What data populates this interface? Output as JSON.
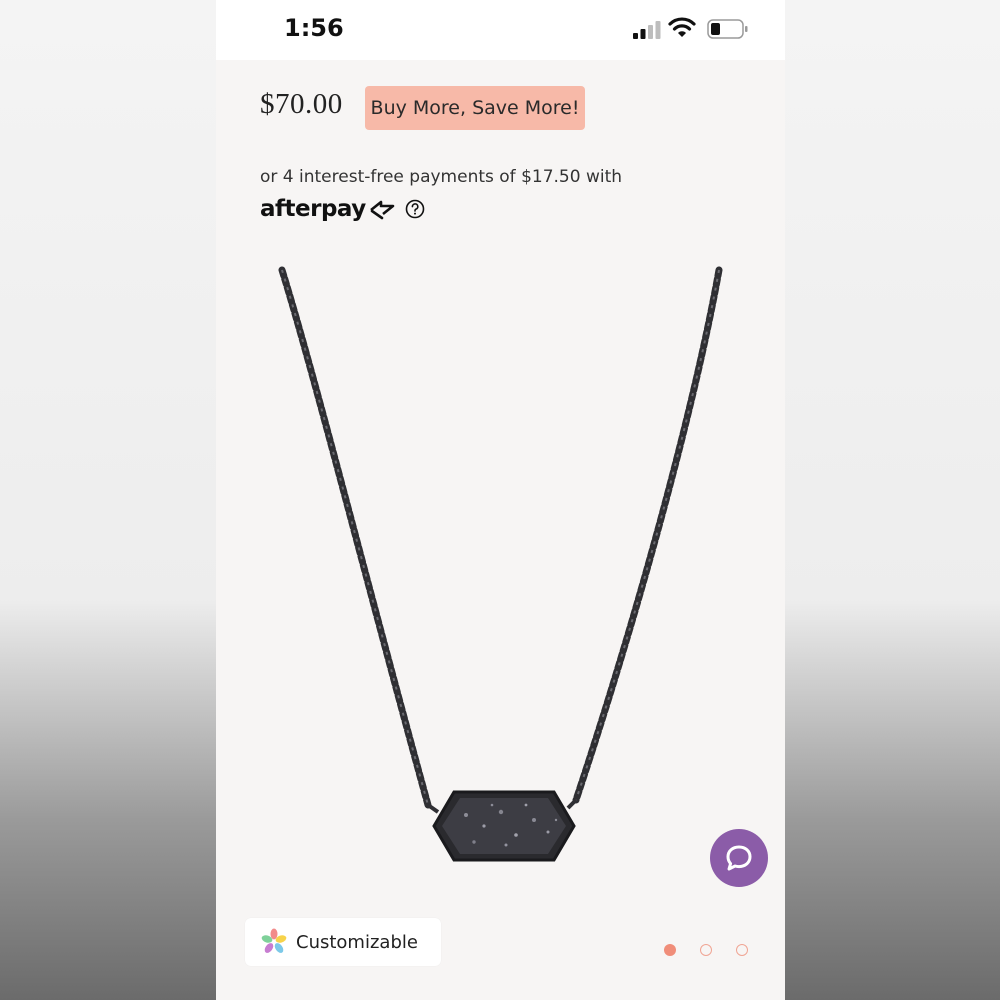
{
  "status_bar": {
    "time": "1:56"
  },
  "product": {
    "price": "$70.00",
    "promo_badge": "Buy More, Save More!",
    "installment_text": "or 4 interest-free payments of $17.50 with",
    "afterpay_logo": "afterpay",
    "image_name": "necklace-product-image"
  },
  "chips": {
    "customizable_label": "Customizable"
  },
  "carousel": {
    "page_count": 3,
    "active_index": 0
  },
  "colors": {
    "promo_badge_bg": "#f7b9a8",
    "chat_button": "#8b5ca8",
    "pager_active": "#f08d79",
    "page_background": "#f7f5f4"
  },
  "icons": {
    "signal": "cellular-signal-icon",
    "wifi": "wifi-icon",
    "battery": "battery-icon",
    "help": "question-circle-icon",
    "chat": "chat-bubble-icon",
    "customizable": "flower-icon"
  }
}
